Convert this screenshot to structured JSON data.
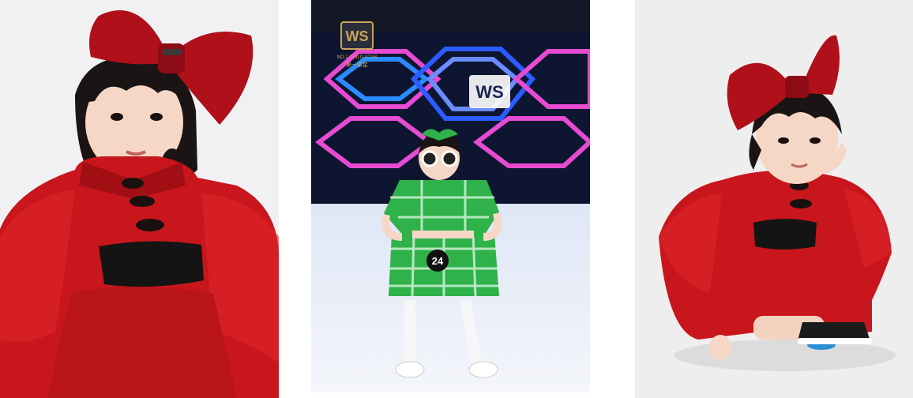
{
  "photos": [
    {
      "name": "girl-red-bow-portrait"
    },
    {
      "name": "runway-green-outfit",
      "logo_mark": "WS",
      "logo_line1": "NO.1 CHILD STAR",
      "logo_line2": "第一童星",
      "screen_mark": "WS",
      "runway_number": "24"
    },
    {
      "name": "girl-red-bow-kneeling"
    }
  ],
  "colors": {
    "dress_red": "#c8161c",
    "bow_red": "#b0101a",
    "plaid_green": "#2fb24a",
    "neon_blue": "#2a5cff",
    "neon_pink": "#e64bd2"
  }
}
